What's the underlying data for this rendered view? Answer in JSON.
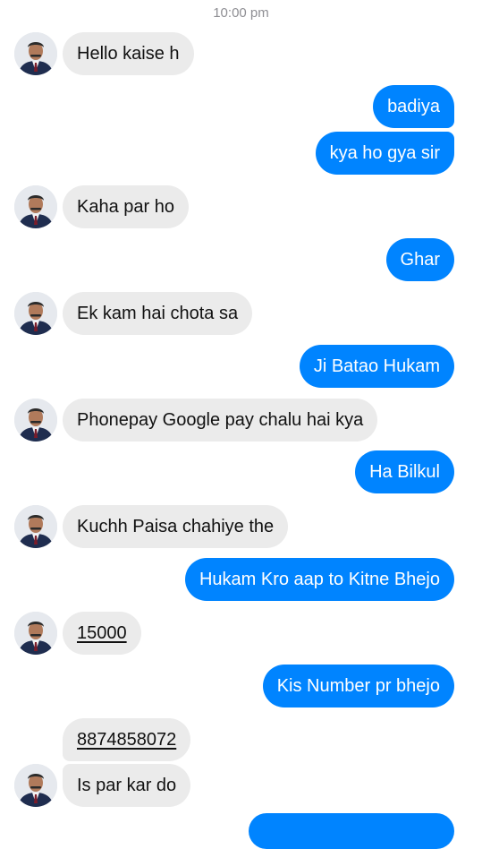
{
  "conversation": {
    "timestamp": "10:00 pm",
    "messages": [
      {
        "from": "contact",
        "text": "Hello kaise h"
      },
      {
        "from": "me",
        "text": "badiya"
      },
      {
        "from": "me",
        "text": "kya ho gya sir"
      },
      {
        "from": "contact",
        "text": "Kaha par ho"
      },
      {
        "from": "me",
        "text": "Ghar"
      },
      {
        "from": "contact",
        "text": "Ek kam hai chota sa"
      },
      {
        "from": "me",
        "text": "Ji Batao Hukam"
      },
      {
        "from": "contact",
        "text": "Phonepay Google pay chalu hai kya"
      },
      {
        "from": "me",
        "text": "Ha Bilkul"
      },
      {
        "from": "contact",
        "text": "Kuchh Paisa chahiye the"
      },
      {
        "from": "me",
        "text": "Hukam Kro aap to Kitne Bhejo"
      },
      {
        "from": "contact",
        "text": "15000"
      },
      {
        "from": "me",
        "text": "Kis Number pr bhejo"
      },
      {
        "from": "contact",
        "text": "8874858072"
      },
      {
        "from": "contact",
        "text": "Is par kar do"
      }
    ]
  },
  "colors": {
    "outgoing_bubble": "#0084ff",
    "incoming_bubble": "#ebebeb",
    "timestamp_text": "#8e8e93"
  }
}
